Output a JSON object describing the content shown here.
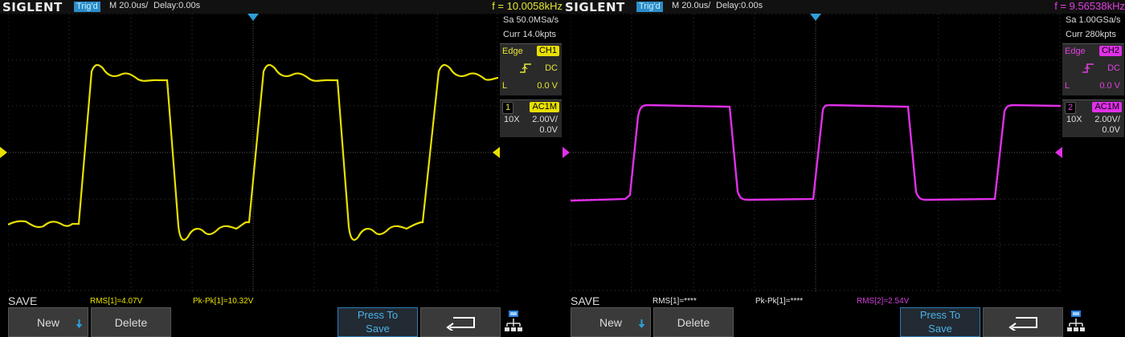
{
  "scopes": [
    {
      "brand": "SIGLENT",
      "trig_status": "Trig'd",
      "timebase": "M 20.0us/",
      "delay": "Delay:0.00s",
      "frequency": "f = 10.0058kHz",
      "freq_color": "#e6e635",
      "trace_color": "#e8e000",
      "sample_rate": "Sa 50.0MSa/s",
      "memory": "Curr 14.0kpts",
      "trigger": {
        "mode": "Edge",
        "source": "CH1",
        "coupling": "DC",
        "level_label": "L",
        "level": "0.0 V"
      },
      "channel": {
        "number": "1",
        "coupling": "AC1M",
        "probe": "10X",
        "scale": "2.00V/",
        "offset": "0.0V"
      },
      "save_label": "SAVE",
      "measurements": [
        {
          "text": "RMS[1]=4.07V",
          "color": "#e8e000"
        },
        {
          "text": "Pk-Pk[1]=10.32V",
          "color": "#e8e000"
        }
      ],
      "buttons": {
        "new": "New",
        "delete": "Delete",
        "press_to": "Press To",
        "save": "Save"
      },
      "icons": [
        "down-arrow-icon",
        "return-arrow-icon",
        "network-icon",
        "trigger-edge-icon"
      ]
    },
    {
      "brand": "SIGLENT",
      "trig_status": "Trig'd",
      "timebase": "M 20.0us/",
      "delay": "Delay:0.00s",
      "frequency": "f = 9.56538kHz",
      "freq_color": "#e040e0",
      "trace_color": "#e030e8",
      "sample_rate": "Sa 1.00GSa/s",
      "memory": "Curr 280kpts",
      "trigger": {
        "mode": "Edge",
        "source": "CH2",
        "coupling": "DC",
        "level_label": "L",
        "level": "0.0 V"
      },
      "channel": {
        "number": "2",
        "coupling": "AC1M",
        "probe": "10X",
        "scale": "2.00V/",
        "offset": "0.0V"
      },
      "save_label": "SAVE",
      "measurements": [
        {
          "text": "RMS[1]=****",
          "color": "#e8e8e8"
        },
        {
          "text": "Pk-Pk[1]=****",
          "color": "#e8e8e8"
        },
        {
          "text": "RMS[2]=2.54V",
          "color": "#d040d8"
        }
      ],
      "buttons": {
        "new": "New",
        "delete": "Delete",
        "press_to": "Press To",
        "save": "Save"
      },
      "icons": [
        "down-arrow-icon",
        "return-arrow-icon",
        "network-icon",
        "trigger-edge-icon"
      ]
    }
  ]
}
